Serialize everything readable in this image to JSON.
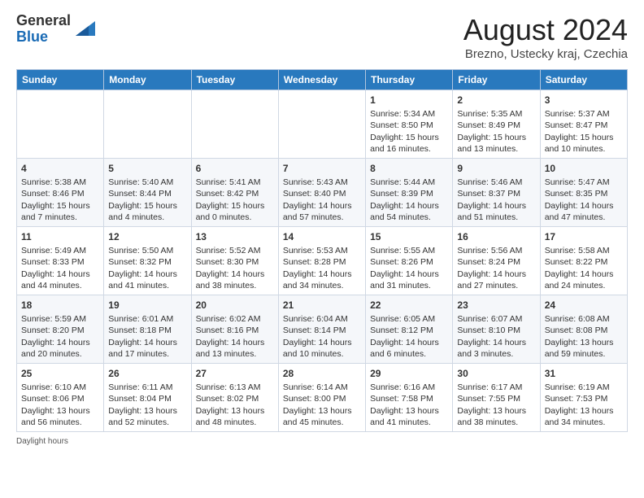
{
  "header": {
    "logo_general": "General",
    "logo_blue": "Blue",
    "month_title": "August 2024",
    "location": "Brezno, Ustecky kraj, Czechia"
  },
  "days_of_week": [
    "Sunday",
    "Monday",
    "Tuesday",
    "Wednesday",
    "Thursday",
    "Friday",
    "Saturday"
  ],
  "weeks": [
    [
      {
        "day": "",
        "info": ""
      },
      {
        "day": "",
        "info": ""
      },
      {
        "day": "",
        "info": ""
      },
      {
        "day": "",
        "info": ""
      },
      {
        "day": "1",
        "info": "Sunrise: 5:34 AM\nSunset: 8:50 PM\nDaylight: 15 hours and 16 minutes."
      },
      {
        "day": "2",
        "info": "Sunrise: 5:35 AM\nSunset: 8:49 PM\nDaylight: 15 hours and 13 minutes."
      },
      {
        "day": "3",
        "info": "Sunrise: 5:37 AM\nSunset: 8:47 PM\nDaylight: 15 hours and 10 minutes."
      }
    ],
    [
      {
        "day": "4",
        "info": "Sunrise: 5:38 AM\nSunset: 8:46 PM\nDaylight: 15 hours and 7 minutes."
      },
      {
        "day": "5",
        "info": "Sunrise: 5:40 AM\nSunset: 8:44 PM\nDaylight: 15 hours and 4 minutes."
      },
      {
        "day": "6",
        "info": "Sunrise: 5:41 AM\nSunset: 8:42 PM\nDaylight: 15 hours and 0 minutes."
      },
      {
        "day": "7",
        "info": "Sunrise: 5:43 AM\nSunset: 8:40 PM\nDaylight: 14 hours and 57 minutes."
      },
      {
        "day": "8",
        "info": "Sunrise: 5:44 AM\nSunset: 8:39 PM\nDaylight: 14 hours and 54 minutes."
      },
      {
        "day": "9",
        "info": "Sunrise: 5:46 AM\nSunset: 8:37 PM\nDaylight: 14 hours and 51 minutes."
      },
      {
        "day": "10",
        "info": "Sunrise: 5:47 AM\nSunset: 8:35 PM\nDaylight: 14 hours and 47 minutes."
      }
    ],
    [
      {
        "day": "11",
        "info": "Sunrise: 5:49 AM\nSunset: 8:33 PM\nDaylight: 14 hours and 44 minutes."
      },
      {
        "day": "12",
        "info": "Sunrise: 5:50 AM\nSunset: 8:32 PM\nDaylight: 14 hours and 41 minutes."
      },
      {
        "day": "13",
        "info": "Sunrise: 5:52 AM\nSunset: 8:30 PM\nDaylight: 14 hours and 38 minutes."
      },
      {
        "day": "14",
        "info": "Sunrise: 5:53 AM\nSunset: 8:28 PM\nDaylight: 14 hours and 34 minutes."
      },
      {
        "day": "15",
        "info": "Sunrise: 5:55 AM\nSunset: 8:26 PM\nDaylight: 14 hours and 31 minutes."
      },
      {
        "day": "16",
        "info": "Sunrise: 5:56 AM\nSunset: 8:24 PM\nDaylight: 14 hours and 27 minutes."
      },
      {
        "day": "17",
        "info": "Sunrise: 5:58 AM\nSunset: 8:22 PM\nDaylight: 14 hours and 24 minutes."
      }
    ],
    [
      {
        "day": "18",
        "info": "Sunrise: 5:59 AM\nSunset: 8:20 PM\nDaylight: 14 hours and 20 minutes."
      },
      {
        "day": "19",
        "info": "Sunrise: 6:01 AM\nSunset: 8:18 PM\nDaylight: 14 hours and 17 minutes."
      },
      {
        "day": "20",
        "info": "Sunrise: 6:02 AM\nSunset: 8:16 PM\nDaylight: 14 hours and 13 minutes."
      },
      {
        "day": "21",
        "info": "Sunrise: 6:04 AM\nSunset: 8:14 PM\nDaylight: 14 hours and 10 minutes."
      },
      {
        "day": "22",
        "info": "Sunrise: 6:05 AM\nSunset: 8:12 PM\nDaylight: 14 hours and 6 minutes."
      },
      {
        "day": "23",
        "info": "Sunrise: 6:07 AM\nSunset: 8:10 PM\nDaylight: 14 hours and 3 minutes."
      },
      {
        "day": "24",
        "info": "Sunrise: 6:08 AM\nSunset: 8:08 PM\nDaylight: 13 hours and 59 minutes."
      }
    ],
    [
      {
        "day": "25",
        "info": "Sunrise: 6:10 AM\nSunset: 8:06 PM\nDaylight: 13 hours and 56 minutes."
      },
      {
        "day": "26",
        "info": "Sunrise: 6:11 AM\nSunset: 8:04 PM\nDaylight: 13 hours and 52 minutes."
      },
      {
        "day": "27",
        "info": "Sunrise: 6:13 AM\nSunset: 8:02 PM\nDaylight: 13 hours and 48 minutes."
      },
      {
        "day": "28",
        "info": "Sunrise: 6:14 AM\nSunset: 8:00 PM\nDaylight: 13 hours and 45 minutes."
      },
      {
        "day": "29",
        "info": "Sunrise: 6:16 AM\nSunset: 7:58 PM\nDaylight: 13 hours and 41 minutes."
      },
      {
        "day": "30",
        "info": "Sunrise: 6:17 AM\nSunset: 7:55 PM\nDaylight: 13 hours and 38 minutes."
      },
      {
        "day": "31",
        "info": "Sunrise: 6:19 AM\nSunset: 7:53 PM\nDaylight: 13 hours and 34 minutes."
      }
    ]
  ],
  "footer": {
    "note": "Daylight hours"
  }
}
